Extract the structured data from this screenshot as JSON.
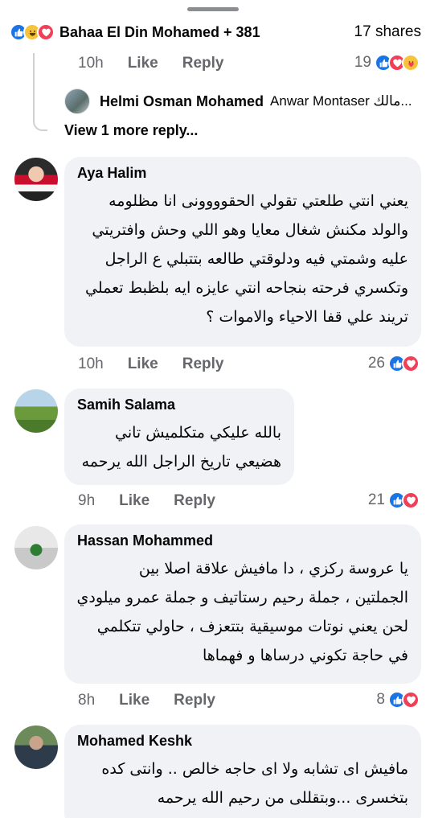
{
  "summary": {
    "names": "Bahaa El Din Mohamed + 381",
    "shares": "17 shares",
    "reaction_icons": [
      "like-icon",
      "haha-icon",
      "love-icon"
    ]
  },
  "prev_comment": {
    "time": "10h",
    "like_label": "Like",
    "reply_label": "Reply",
    "reaction_count": "19",
    "reaction_icons": [
      "like-icon",
      "love-icon",
      "care-icon"
    ]
  },
  "reply_preview": {
    "name": "Helmi Osman Mohamed",
    "text": "Anwar Montaser مالك..."
  },
  "view_more": "View 1 more reply...",
  "comments": [
    {
      "author": "Aya Halim",
      "lines": [
        "يعني انتي طلعتي تقولي الحقوووونى انا مظلومه",
        "والولد مكنش شغال معايا وهو اللي وحش وافتريتي",
        "عليه وشمتي فيه ودلوقتي طالعه بتتبلي ع الراجل",
        "وتكسري فرحته بنجاحه انتي عايزه ايه بلظبط تعملي",
        "تريند علي قفا الاحياء والاموات ؟"
      ],
      "time": "10h",
      "like_label": "Like",
      "reply_label": "Reply",
      "reaction_count": "26",
      "reaction_icons": [
        "like-icon",
        "love-icon"
      ]
    },
    {
      "author": "Samih Salama",
      "lines": [
        "بالله عليكي متكلميش تاني",
        "هضيعي تاريخ الراجل  الله يرحمه"
      ],
      "time": "9h",
      "like_label": "Like",
      "reply_label": "Reply",
      "reaction_count": "21",
      "reaction_icons": [
        "like-icon",
        "love-icon"
      ]
    },
    {
      "author": "Hassan Mohammed",
      "lines": [
        "يا عروسة ركزي ، دا مافيش علاقة اصلا بين",
        "الجملتين ، جملة رحيم رستاتيف و جملة عمرو ميلودي",
        "لحن يعني نوتات موسيقية بتتعزف ، حاولي تتكلمي",
        "في حاجة تكوني درساها و فهماها"
      ],
      "time": "8h",
      "like_label": "Like",
      "reply_label": "Reply",
      "reaction_count": "8",
      "reaction_icons": [
        "like-icon",
        "love-icon"
      ]
    },
    {
      "author": "Mohamed Keshk",
      "lines": [
        "مافيش اى تشابه ولا اى حاجه خالص .. وانتى كده",
        "بتخسرى ...وبتقللى من رحيم الله يرحمه"
      ]
    }
  ],
  "colors": {
    "like": "#1b74e4",
    "love": "#f33e58",
    "haha": "#f7c33b",
    "bubble": "#f0f2f5",
    "secondary_text": "#65676b"
  }
}
